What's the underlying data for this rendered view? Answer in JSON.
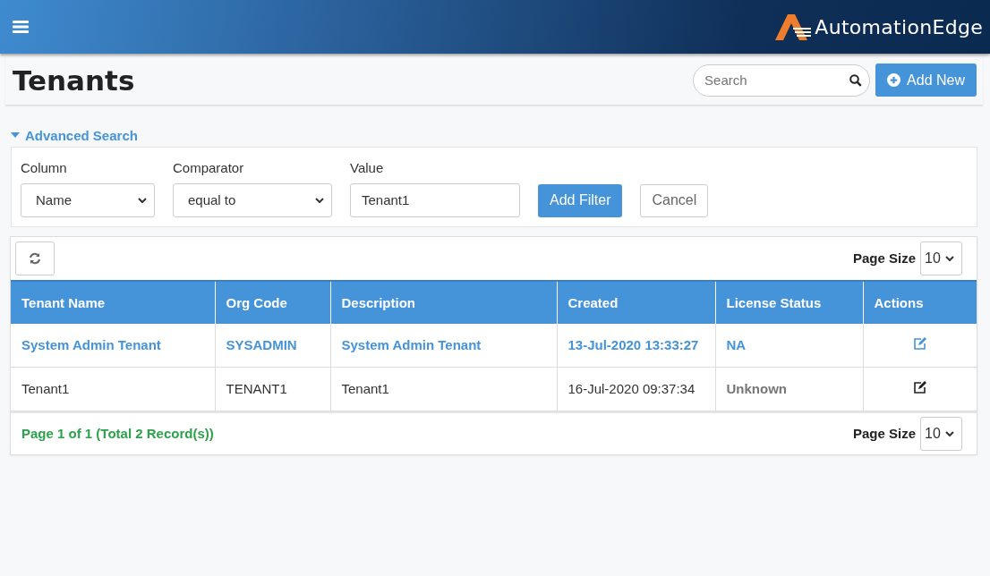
{
  "header": {
    "logo_text": "AutomationEdge"
  },
  "page": {
    "title": "Tenants",
    "search": {
      "placeholder": "Search"
    },
    "add_button": "Add New"
  },
  "advanced_search": {
    "label": "Advanced Search",
    "expanded": true,
    "fields": [
      {
        "kind": "select",
        "label": "Column",
        "value": "Name"
      },
      {
        "kind": "select",
        "label": "Comparator",
        "value": "equal to"
      },
      {
        "kind": "input",
        "label": "Value",
        "value": "Tenant1"
      }
    ],
    "add_filter": "Add Filter",
    "cancel": "Cancel"
  },
  "table": {
    "page_size_label": "Page Size",
    "page_size": "10",
    "columns": [
      "Tenant Name",
      "Org Code",
      "Description",
      "Created",
      "License Status",
      "Actions"
    ],
    "rows": [
      {
        "selected": true,
        "cells": [
          "System Admin Tenant",
          "SYSADMIN",
          "System Admin Tenant",
          "13-Jul-2020 13:33:27"
        ],
        "license_status": {
          "text": "NA",
          "muted": false
        }
      },
      {
        "selected": false,
        "cells": [
          "Tenant1",
          "TENANT1",
          "Tenant1",
          "16-Jul-2020 09:37:34"
        ],
        "license_status": {
          "text": "Unknown",
          "muted": true
        }
      }
    ],
    "footer": {
      "summary": "Page 1 of 1 (Total 2 Record(s))",
      "page_size_label": "Page Size",
      "page_size": "10"
    }
  }
}
